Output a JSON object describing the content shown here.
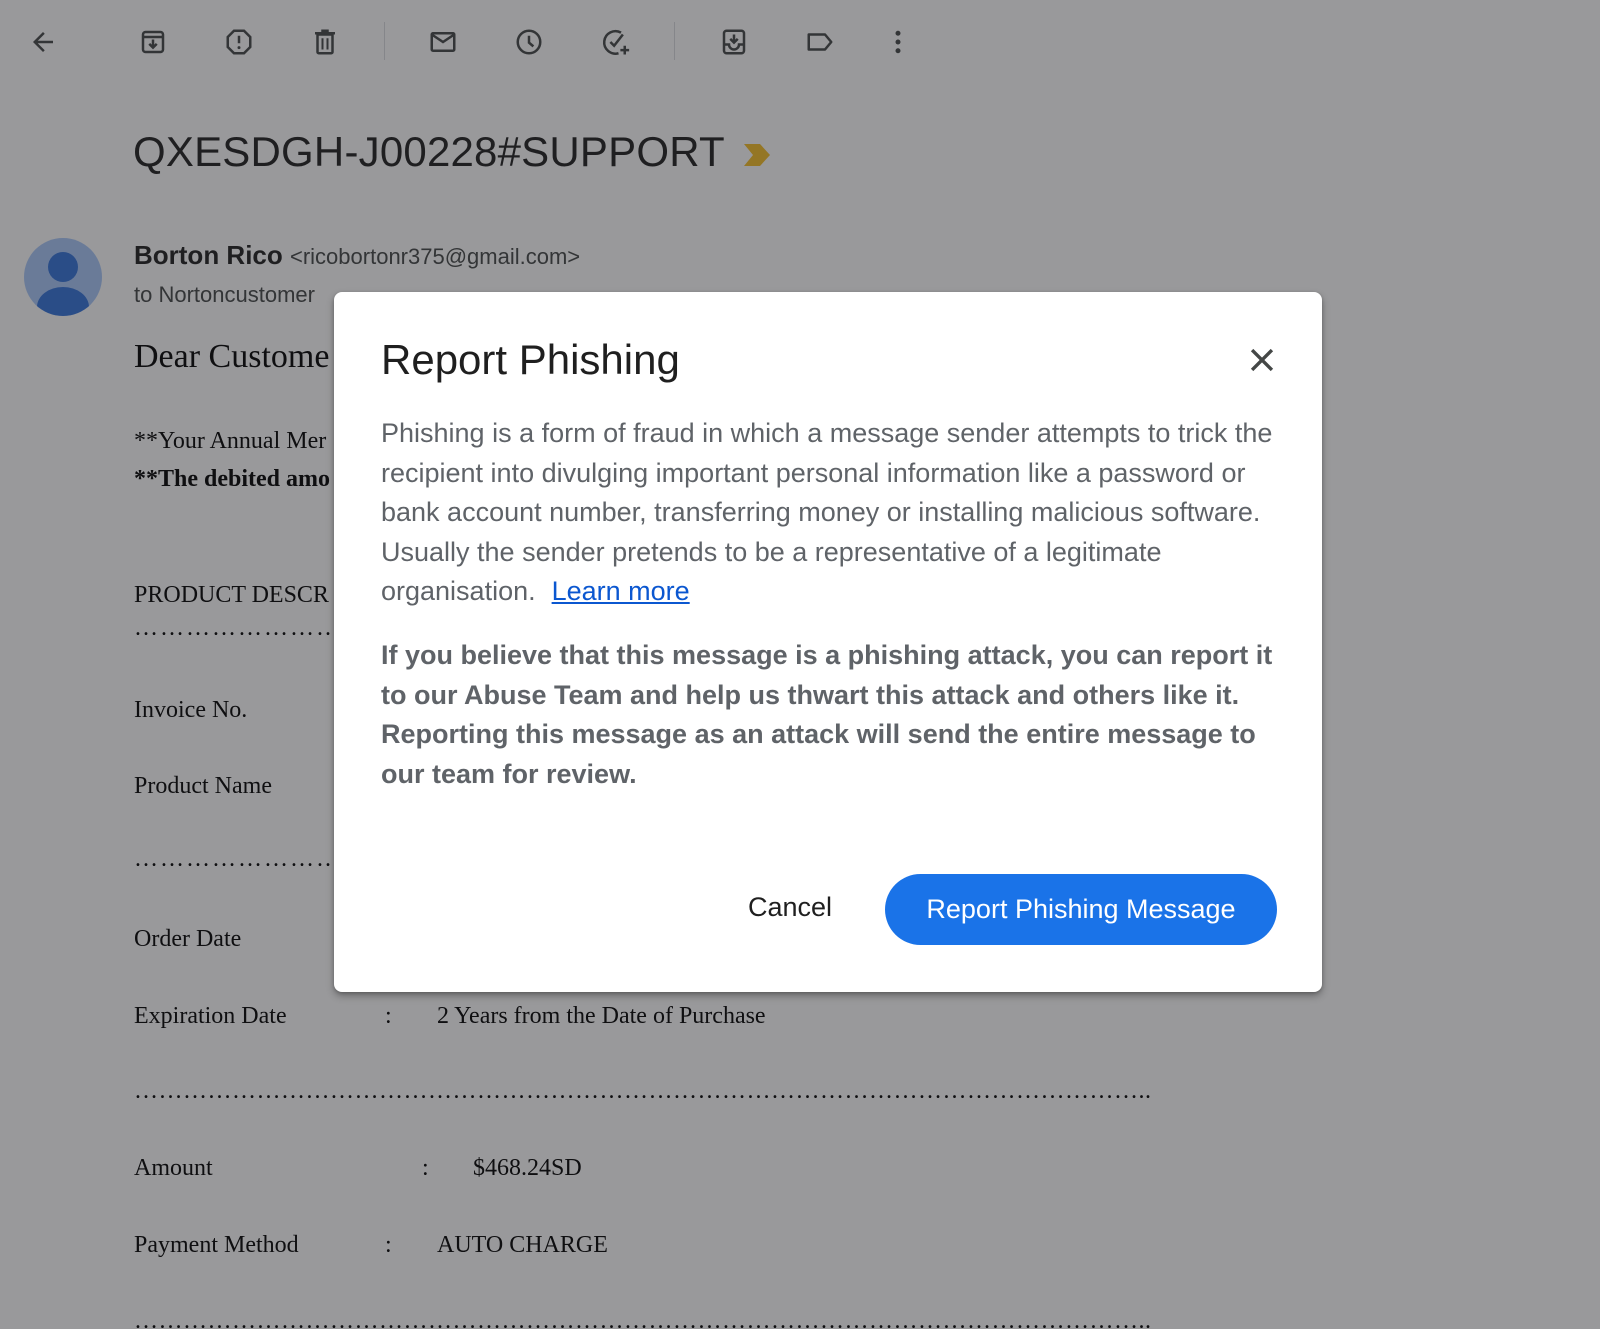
{
  "toolbar": {
    "items": [
      {
        "name": "back-arrow-icon",
        "label": "Back"
      },
      {
        "name": "archive-icon",
        "label": "Archive"
      },
      {
        "name": "report-spam-icon",
        "label": "Report spam"
      },
      {
        "name": "delete-icon",
        "label": "Delete"
      },
      {
        "name": "mark-unread-icon",
        "label": "Mark as unread"
      },
      {
        "name": "snooze-icon",
        "label": "Snooze"
      },
      {
        "name": "add-to-tasks-icon",
        "label": "Add to Tasks"
      },
      {
        "name": "move-to-icon",
        "label": "Move to"
      },
      {
        "name": "label-icon",
        "label": "Labels"
      },
      {
        "name": "more-vert-icon",
        "label": "More"
      }
    ]
  },
  "email": {
    "subject": "QXESDGH-J00228#SUPPORT",
    "importance_marker": "important-marker-icon",
    "sender_name": "Borton Rico",
    "sender_email": "<ricobortonr375@gmail.com>",
    "recipient_visible": "to Nortoncustomer",
    "greeting": "Dear Custome",
    "line1": "**Your Annual Mer",
    "line2": "**The debited amo",
    "product_desc": "PRODUCT DESCR",
    "dots_short": "…………………………",
    "invoice_label": "Invoice No.",
    "product_name_label": "Product Name",
    "order_date_label": "Order Date",
    "expiration_label": "Expiration Date",
    "expiration_colon": ":",
    "expiration_value": "2 Years from the Date of Purchase",
    "dots_long": "……………………………………………………………………………………………………………..",
    "amount_label": "Amount",
    "amount_colon": ":",
    "amount_value": "$468.24SD",
    "payment_label": "Payment Method",
    "payment_colon": ":",
    "payment_value": "AUTO CHARGE"
  },
  "dialog": {
    "title": "Report Phishing",
    "close_label": "Close",
    "paragraph1": "Phishing is a form of fraud in which a message sender attempts to trick the recipient into divulging important personal information like a password or bank account number, transferring money or installing malicious software. Usually the sender pretends to be a representative of a legitimate organisation.",
    "learn_more": "Learn more",
    "paragraph2": "If you believe that this message is a phishing attack, you can report it to our Abuse Team and help us thwart this attack and others like it. Reporting this message as an attack will send the entire message to our team for review.",
    "cancel_label": "Cancel",
    "confirm_label": "Report Phishing Message"
  },
  "colors": {
    "primary_button": "#1a73e8",
    "link": "#0b57d0",
    "importance": "#f4b400",
    "scrim": "rgba(32,33,36,0.46)"
  }
}
